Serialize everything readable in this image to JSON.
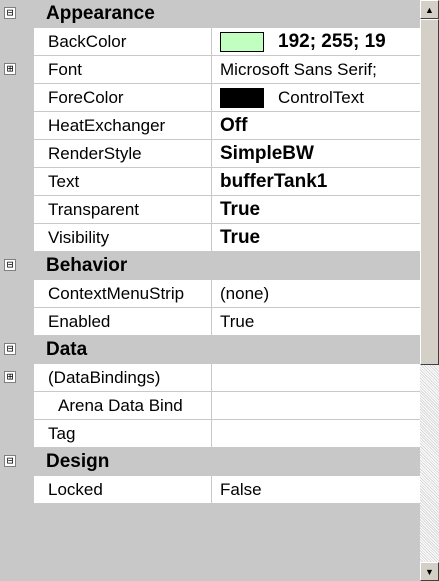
{
  "categories": {
    "appearance": {
      "label": "Appearance",
      "toggle": "⊟",
      "properties": {
        "backcolor": {
          "name": "BackColor",
          "value": "192; 255; 19",
          "swatch": "#c0ffc0"
        },
        "font": {
          "name": "Font",
          "value": "Microsoft Sans Serif;",
          "toggle": "⊞"
        },
        "forecolor": {
          "name": "ForeColor",
          "value": "ControlText",
          "swatch": "#000000"
        },
        "heatexchanger": {
          "name": "HeatExchanger",
          "value": "Off"
        },
        "renderstyle": {
          "name": "RenderStyle",
          "value": "SimpleBW"
        },
        "text": {
          "name": "Text",
          "value": "bufferTank1"
        },
        "transparent": {
          "name": "Transparent",
          "value": "True"
        },
        "visibility": {
          "name": "Visibility",
          "value": "True"
        }
      }
    },
    "behavior": {
      "label": "Behavior",
      "toggle": "⊟",
      "properties": {
        "contextmenustrip": {
          "name": "ContextMenuStrip",
          "value": "(none)"
        },
        "enabled": {
          "name": "Enabled",
          "value": "True"
        }
      }
    },
    "data": {
      "label": "Data",
      "toggle": "⊟",
      "properties": {
        "databindings": {
          "name": "(DataBindings)",
          "value": "",
          "toggle": "⊞"
        },
        "arenadatabind": {
          "name": "Arena Data Bind",
          "value": ""
        },
        "tag": {
          "name": "Tag",
          "value": ""
        }
      }
    },
    "design": {
      "label": "Design",
      "toggle": "⊟",
      "properties": {
        "locked": {
          "name": "Locked",
          "value": "False"
        }
      }
    }
  },
  "scrollbar": {
    "up_arrow": "▲",
    "down_arrow": "▼"
  },
  "colors": {
    "category_background": "#c8c8c8",
    "gridline": "#c8c8c8",
    "cell_background": "#ffffff"
  }
}
